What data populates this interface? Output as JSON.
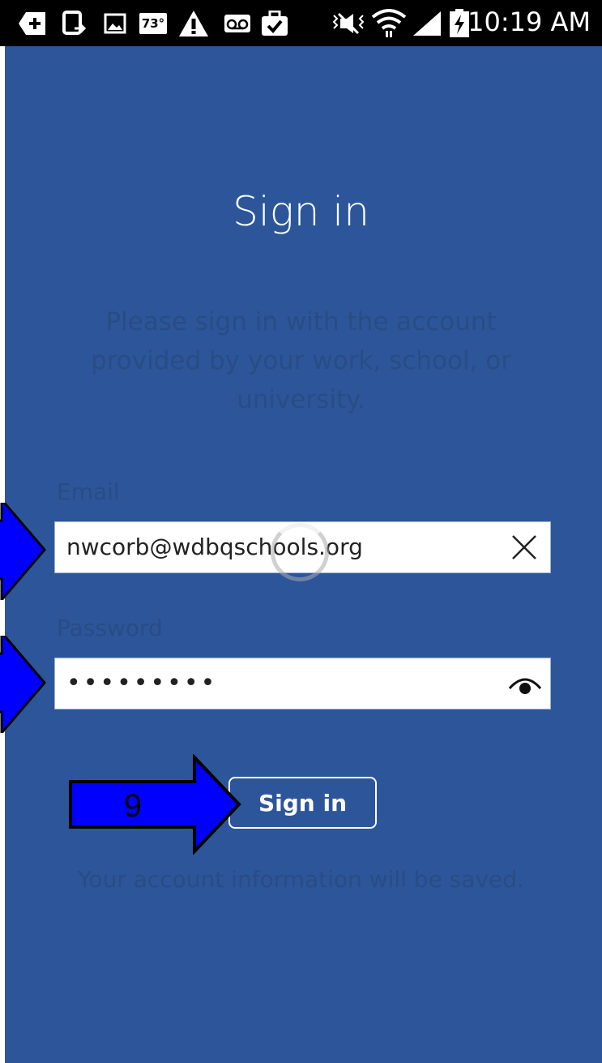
{
  "status_bar": {
    "time": "10:19 AM",
    "temperature_badge": "73°",
    "icons": [
      "add-icon",
      "screen-cast-icon",
      "image-icon",
      "temperature-icon",
      "warning-icon",
      "voicemail-icon",
      "briefcase-check-icon",
      "mute-vibrate-icon",
      "wifi-icon",
      "signal-icon",
      "battery-charging-icon"
    ]
  },
  "page": {
    "title": "Sign in",
    "subtitle": "Please sign in with the account provided by your work, school, or university.",
    "email_label": "Email",
    "email_value": "nwcorb@wdbqschools.org",
    "password_label": "Password",
    "password_value": "•••••••••",
    "signin_button": "Sign in",
    "footer_note": "Your account information will be saved."
  },
  "annotations": {
    "step_number": "9",
    "arrow_color": "#0000ff"
  },
  "colors": {
    "background": "#2c5699",
    "dim_text": "#2a4c85",
    "field_bg": "#ffffff"
  }
}
